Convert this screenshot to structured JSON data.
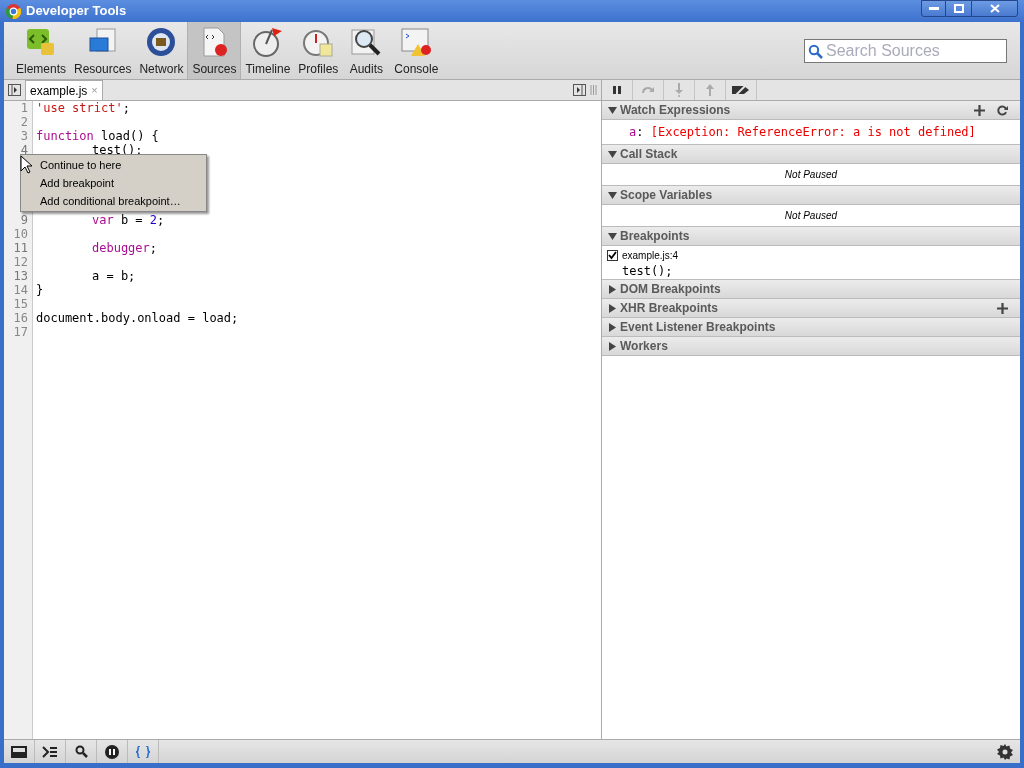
{
  "window": {
    "title": "Developer Tools"
  },
  "panels": [
    {
      "label": "Elements",
      "selected": false
    },
    {
      "label": "Resources",
      "selected": false
    },
    {
      "label": "Network",
      "selected": false
    },
    {
      "label": "Sources",
      "selected": true
    },
    {
      "label": "Timeline",
      "selected": false
    },
    {
      "label": "Profiles",
      "selected": false
    },
    {
      "label": "Audits",
      "selected": false
    },
    {
      "label": "Console",
      "selected": false
    }
  ],
  "search": {
    "placeholder": "Search Sources"
  },
  "editor": {
    "tab": {
      "label": "example.js",
      "close": "×"
    },
    "lines": [
      {
        "number": "1",
        "indented": false,
        "tokens": [
          {
            "t": "'use strict'",
            "kind": "string"
          },
          {
            "t": ";",
            "kind": "plain"
          }
        ]
      },
      {
        "number": "2",
        "indented": false
      },
      {
        "number": "3",
        "indented": false,
        "tokens": [
          {
            "t": "function",
            "kind": "keyword"
          },
          {
            "t": "load() {",
            "kind": "plain"
          }
        ]
      },
      {
        "number": "4",
        "indented": true,
        "tokens": [
          {
            "t": "test();",
            "kind": "plain"
          }
        ]
      },
      {
        "number": "9",
        "indented": true,
        "tokens": [
          {
            "t": "var",
            "kind": "keyword"
          },
          {
            "t": "b =",
            "kind": "plain"
          },
          {
            "t": "2",
            "kind": "number"
          },
          {
            "t": ";",
            "kind": "plain"
          }
        ]
      },
      {
        "number": "10",
        "indented": false
      },
      {
        "number": "11",
        "indented": true,
        "tokens": [
          {
            "t": "debugger",
            "kind": "keyword"
          },
          {
            "t": ";",
            "kind": "plain"
          }
        ]
      },
      {
        "number": "12",
        "indented": false
      },
      {
        "number": "13",
        "indented": true,
        "tokens": [
          {
            "t": "a = b;",
            "kind": "plain"
          }
        ]
      },
      {
        "number": "14",
        "indented": false,
        "tokens": [
          {
            "t": "}",
            "kind": "plain"
          }
        ]
      },
      {
        "number": "15",
        "indented": false
      },
      {
        "number": "16",
        "indented": false,
        "tokens": [
          {
            "t": "document.body.onload = load;",
            "kind": "plain"
          }
        ]
      },
      {
        "number": "17",
        "indented": false
      }
    ]
  },
  "context_menu": [
    "Continue to here",
    "Add breakpoint",
    "Add conditional breakpoint…"
  ],
  "debugger_buttons": [
    {
      "disabled": false
    },
    {
      "disabled": true
    },
    {
      "disabled": true
    },
    {
      "disabled": true
    },
    {
      "disabled": false
    }
  ],
  "sections": [
    {
      "title": "Watch Expressions",
      "expanded": true,
      "actions": [
        {
          "kind": "add"
        },
        {
          "kind": "refresh"
        }
      ],
      "kind": "watch",
      "name": "a",
      "separator": ":",
      "value": "[Exception: ReferenceError: a is not defined]"
    },
    {
      "title": "Call Stack",
      "expanded": true,
      "kind": "message",
      "message": "Not Paused"
    },
    {
      "title": "Scope Variables",
      "expanded": true,
      "kind": "message",
      "message": "Not Paused"
    },
    {
      "title": "Breakpoints",
      "expanded": true,
      "kind": "breakpoints",
      "items": [
        {
          "location": "example.js:4",
          "code": "test();",
          "checked": true
        }
      ]
    },
    {
      "title": "DOM Breakpoints",
      "expanded": false
    },
    {
      "title": "XHR Breakpoints",
      "expanded": false,
      "actions": [
        {
          "kind": "add"
        }
      ]
    },
    {
      "title": "Event Listener Breakpoints",
      "expanded": false
    },
    {
      "title": "Workers",
      "expanded": false
    }
  ],
  "status_bar": [
    {
      "selected": false
    },
    {
      "selected": false
    },
    {
      "selected": false
    },
    {
      "selected": false
    },
    {
      "selected": true
    }
  ]
}
